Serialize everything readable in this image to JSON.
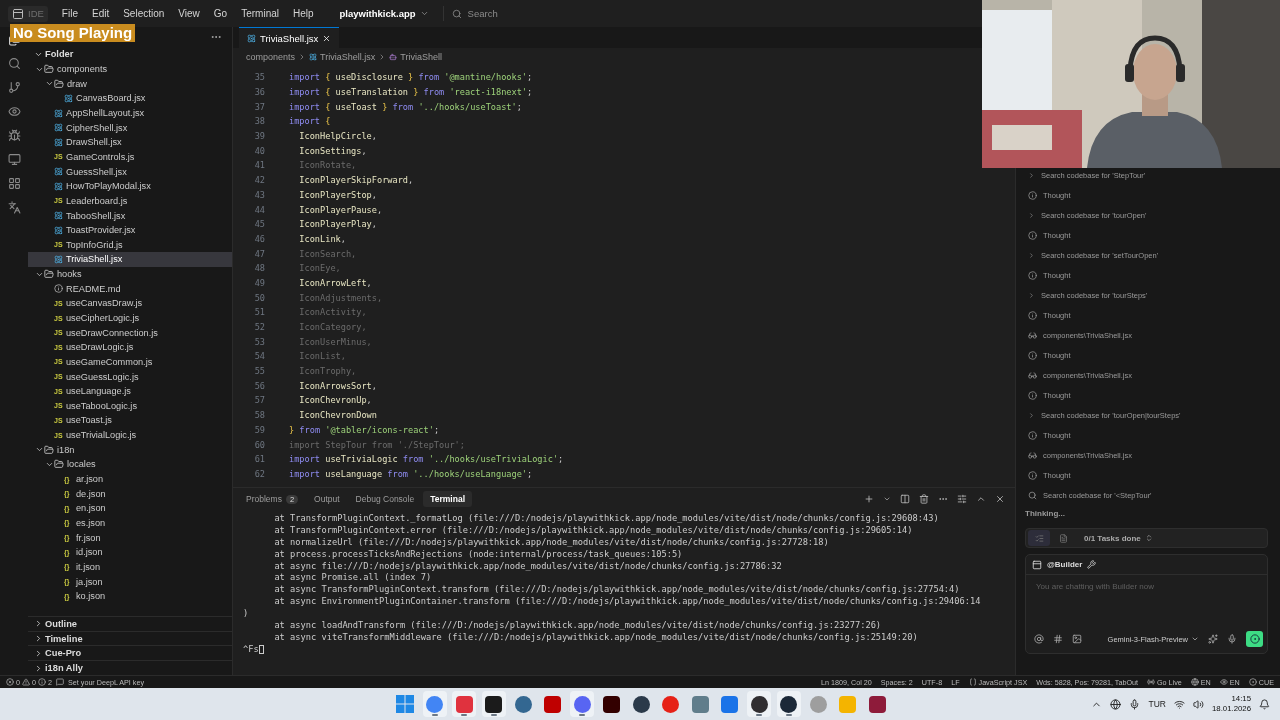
{
  "title_bar": {
    "app_label": "IDE",
    "menu": [
      "File",
      "Edit",
      "Selection",
      "View",
      "Go",
      "Terminal",
      "Help"
    ],
    "workspace": "playwithkick.app",
    "search": {
      "placeholder": "Search"
    }
  },
  "overlay": {
    "now_playing": "No Song Playing"
  },
  "sidebar": {
    "root": {
      "label": "Folder",
      "expanded": true
    },
    "tree": [
      {
        "label": "components",
        "kind": "folder",
        "expanded": true,
        "selected": false,
        "children": [
          {
            "label": "draw",
            "kind": "folder",
            "expanded": true,
            "selected": false,
            "children": [
              {
                "label": "CanvasBoard.jsx",
                "kind": "jsx",
                "selected": false
              }
            ]
          },
          {
            "label": "AppShellLayout.jsx",
            "kind": "jsx",
            "selected": false
          },
          {
            "label": "CipherShell.jsx",
            "kind": "jsx",
            "selected": false
          },
          {
            "label": "DrawShell.jsx",
            "kind": "jsx",
            "selected": false
          },
          {
            "label": "GameControls.js",
            "kind": "js",
            "badge": "JS",
            "selected": false
          },
          {
            "label": "GuessShell.jsx",
            "kind": "jsx",
            "selected": false
          },
          {
            "label": "HowToPlayModal.jsx",
            "kind": "jsx",
            "selected": false
          },
          {
            "label": "Leaderboard.js",
            "kind": "js",
            "badge": "JS",
            "selected": false
          },
          {
            "label": "TabooShell.jsx",
            "kind": "jsx",
            "selected": false
          },
          {
            "label": "ToastProvider.jsx",
            "kind": "jsx",
            "selected": false
          },
          {
            "label": "TopInfoGrid.js",
            "kind": "js",
            "badge": "JS",
            "selected": false
          },
          {
            "label": "TriviaShell.jsx",
            "kind": "jsx",
            "selected": true
          }
        ]
      },
      {
        "label": "hooks",
        "kind": "folder",
        "expanded": true,
        "selected": false,
        "children": [
          {
            "label": "README.md",
            "kind": "md",
            "selected": false
          },
          {
            "label": "useCanvasDraw.js",
            "kind": "js",
            "badge": "JS",
            "selected": false
          },
          {
            "label": "useCipherLogic.js",
            "kind": "js",
            "badge": "JS",
            "selected": false
          },
          {
            "label": "useDrawConnection.js",
            "kind": "js",
            "badge": "JS",
            "selected": false
          },
          {
            "label": "useDrawLogic.js",
            "kind": "js",
            "badge": "JS",
            "selected": false
          },
          {
            "label": "useGameCommon.js",
            "kind": "js",
            "badge": "JS",
            "selected": false
          },
          {
            "label": "useGuessLogic.js",
            "kind": "js",
            "badge": "JS",
            "selected": false
          },
          {
            "label": "useLanguage.js",
            "kind": "js",
            "badge": "JS",
            "selected": false
          },
          {
            "label": "useTabooLogic.js",
            "kind": "js",
            "badge": "JS",
            "selected": false
          },
          {
            "label": "useToast.js",
            "kind": "js",
            "badge": "JS",
            "selected": false
          },
          {
            "label": "useTrivialLogic.js",
            "kind": "js",
            "badge": "JS",
            "selected": false
          }
        ]
      },
      {
        "label": "i18n",
        "kind": "folder",
        "expanded": true,
        "selected": false,
        "children": [
          {
            "label": "locales",
            "kind": "folder",
            "expanded": true,
            "selected": false,
            "children": [
              {
                "label": "ar.json",
                "kind": "json",
                "badge": "{}",
                "selected": false
              },
              {
                "label": "de.json",
                "kind": "json",
                "badge": "{}",
                "selected": false
              },
              {
                "label": "en.json",
                "kind": "json",
                "badge": "{}",
                "selected": false
              },
              {
                "label": "es.json",
                "kind": "json",
                "badge": "{}",
                "selected": false
              },
              {
                "label": "fr.json",
                "kind": "json",
                "badge": "{}",
                "selected": false
              },
              {
                "label": "id.json",
                "kind": "json",
                "badge": "{}",
                "selected": false
              },
              {
                "label": "it.json",
                "kind": "json",
                "badge": "{}",
                "selected": false
              },
              {
                "label": "ja.json",
                "kind": "json",
                "badge": "{}",
                "selected": false
              },
              {
                "label": "ko.json",
                "kind": "json",
                "badge": "{}",
                "selected": false
              }
            ]
          }
        ]
      }
    ],
    "sections": [
      {
        "label": "Outline",
        "expanded": false
      },
      {
        "label": "Timeline",
        "expanded": false
      },
      {
        "label": "Cue-Pro",
        "expanded": false
      },
      {
        "label": "i18n Ally",
        "expanded": false
      }
    ]
  },
  "editor": {
    "tabs": [
      {
        "label": "TriviaShell.jsx",
        "selected": true
      }
    ],
    "breadcrumb": [
      "components",
      "TriviaShell.jsx",
      "TriviaShell"
    ],
    "lines": [
      {
        "number": "35",
        "tokens": [
          {
            "kind": "kw",
            "text": "import "
          },
          {
            "kind": "br",
            "text": "{ "
          },
          {
            "kind": "id",
            "text": "useDisclosure "
          },
          {
            "kind": "br",
            "text": "} "
          },
          {
            "kind": "kw",
            "text": "from "
          },
          {
            "kind": "str",
            "text": "'@mantine/hooks'"
          },
          {
            "kind": "p",
            "text": ";"
          }
        ]
      },
      {
        "number": "36",
        "tokens": [
          {
            "kind": "kw",
            "text": "import "
          },
          {
            "kind": "br",
            "text": "{ "
          },
          {
            "kind": "id",
            "text": "useTranslation "
          },
          {
            "kind": "br",
            "text": "} "
          },
          {
            "kind": "kw",
            "text": "from "
          },
          {
            "kind": "str",
            "text": "'react-i18next'"
          },
          {
            "kind": "p",
            "text": ";"
          }
        ]
      },
      {
        "number": "37",
        "tokens": [
          {
            "kind": "kw",
            "text": "import "
          },
          {
            "kind": "br",
            "text": "{ "
          },
          {
            "kind": "id",
            "text": "useToast "
          },
          {
            "kind": "br",
            "text": "} "
          },
          {
            "kind": "kw",
            "text": "from "
          },
          {
            "kind": "str",
            "text": "'../hooks/useToast'"
          },
          {
            "kind": "p",
            "text": ";"
          }
        ]
      },
      {
        "number": "38",
        "tokens": [
          {
            "kind": "kw",
            "text": "import "
          },
          {
            "kind": "br",
            "text": "{"
          }
        ]
      },
      {
        "number": "39",
        "tokens": [
          {
            "kind": "id",
            "text": "  IconHelpCircle"
          },
          {
            "kind": "p",
            "text": ","
          }
        ]
      },
      {
        "number": "40",
        "tokens": [
          {
            "kind": "id",
            "text": "  IconSettings"
          },
          {
            "kind": "p",
            "text": ","
          }
        ]
      },
      {
        "number": "41",
        "tokens": [
          {
            "kind": "dim",
            "text": "  IconRotate,"
          }
        ]
      },
      {
        "number": "42",
        "tokens": [
          {
            "kind": "id",
            "text": "  IconPlayerSkipForward"
          },
          {
            "kind": "p",
            "text": ","
          }
        ]
      },
      {
        "number": "43",
        "tokens": [
          {
            "kind": "id",
            "text": "  IconPlayerStop"
          },
          {
            "kind": "p",
            "text": ","
          }
        ]
      },
      {
        "number": "44",
        "tokens": [
          {
            "kind": "id",
            "text": "  IconPlayerPause"
          },
          {
            "kind": "p",
            "text": ","
          }
        ]
      },
      {
        "number": "45",
        "tokens": [
          {
            "kind": "id",
            "text": "  IconPlayerPlay"
          },
          {
            "kind": "p",
            "text": ","
          }
        ]
      },
      {
        "number": "46",
        "tokens": [
          {
            "kind": "id",
            "text": "  IconLink"
          },
          {
            "kind": "p",
            "text": ","
          }
        ]
      },
      {
        "number": "47",
        "tokens": [
          {
            "kind": "dim",
            "text": "  IconSearch,"
          }
        ]
      },
      {
        "number": "48",
        "tokens": [
          {
            "kind": "dim",
            "text": "  IconEye,"
          }
        ]
      },
      {
        "number": "49",
        "tokens": [
          {
            "kind": "id",
            "text": "  IconArrowLeft"
          },
          {
            "kind": "p",
            "text": ","
          }
        ]
      },
      {
        "number": "50",
        "tokens": [
          {
            "kind": "dim",
            "text": "  IconAdjustments,"
          }
        ]
      },
      {
        "number": "51",
        "tokens": [
          {
            "kind": "dim",
            "text": "  IconActivity,"
          }
        ]
      },
      {
        "number": "52",
        "tokens": [
          {
            "kind": "dim",
            "text": "  IconCategory,"
          }
        ]
      },
      {
        "number": "53",
        "tokens": [
          {
            "kind": "dim",
            "text": "  IconUserMinus,"
          }
        ]
      },
      {
        "number": "54",
        "tokens": [
          {
            "kind": "dim",
            "text": "  IconList,"
          }
        ]
      },
      {
        "number": "55",
        "tokens": [
          {
            "kind": "dim",
            "text": "  IconTrophy,"
          }
        ]
      },
      {
        "number": "56",
        "tokens": [
          {
            "kind": "id",
            "text": "  IconArrowsSort"
          },
          {
            "kind": "p",
            "text": ","
          }
        ]
      },
      {
        "number": "57",
        "tokens": [
          {
            "kind": "id",
            "text": "  IconChevronUp"
          },
          {
            "kind": "p",
            "text": ","
          }
        ]
      },
      {
        "number": "58",
        "tokens": [
          {
            "kind": "id",
            "text": "  IconChevronDown"
          }
        ]
      },
      {
        "number": "59",
        "tokens": [
          {
            "kind": "br",
            "text": "} "
          },
          {
            "kind": "kw",
            "text": "from "
          },
          {
            "kind": "str",
            "text": "'@tabler/icons-react'"
          },
          {
            "kind": "p",
            "text": ";"
          }
        ]
      },
      {
        "number": "60",
        "tokens": [
          {
            "kind": "dim",
            "text": "import StepTour from './StepTour';"
          }
        ]
      },
      {
        "number": "61",
        "tokens": [
          {
            "kind": "kw",
            "text": "import "
          },
          {
            "kind": "id",
            "text": "useTriviaLogic "
          },
          {
            "kind": "kw",
            "text": "from "
          },
          {
            "kind": "str",
            "text": "'../hooks/useTriviaLogic'"
          },
          {
            "kind": "p",
            "text": ";"
          }
        ]
      },
      {
        "number": "62",
        "tokens": [
          {
            "kind": "kw",
            "text": "import "
          },
          {
            "kind": "id",
            "text": "useLanguage "
          },
          {
            "kind": "kw",
            "text": "from "
          },
          {
            "kind": "str",
            "text": "'../hooks/useLanguage'"
          },
          {
            "kind": "p",
            "text": ";"
          }
        ]
      }
    ]
  },
  "panel": {
    "tabs": [
      {
        "label": "Problems",
        "count": "2",
        "selected": false
      },
      {
        "label": "Output",
        "selected": false
      },
      {
        "label": "Debug Console",
        "selected": false
      },
      {
        "label": "Terminal",
        "selected": true
      }
    ],
    "lines": [
      "      at TransformPluginContext._formatLog (file:///D:/nodejs/playwithkick.app/node_modules/vite/dist/node/chunks/config.js:29608:43)",
      "      at TransformPluginContext.error (file:///D:/nodejs/playwithkick.app/node_modules/vite/dist/node/chunks/config.js:29605:14)",
      "      at normalizeUrl (file:///D:/nodejs/playwithkick.app/node_modules/vite/dist/node/chunks/config.js:27728:18)",
      "      at process.processTicksAndRejections (node:internal/process/task_queues:105:5)",
      "      at async file:///D:/nodejs/playwithkick.app/node_modules/vite/dist/node/chunks/config.js:27786:32",
      "      at async Promise.all (index 7)",
      "      at async TransformPluginContext.transform (file:///D:/nodejs/playwithkick.app/node_modules/vite/dist/node/chunks/config.js:27754:4)",
      "      at async EnvironmentPluginContainer.transform (file:///D:/nodejs/playwithkick.app/node_modules/vite/dist/node/chunks/config.js:29406:14",
      ")",
      "      at async loadAndTransform (file:///D:/nodejs/playwithkick.app/node_modules/vite/dist/node/chunks/config.js:23277:26)",
      "      at async viteTransformMiddleware (file:///D:/nodejs/playwithkick.app/node_modules/vite/dist/node/chunks/config.js:25149:20)"
    ],
    "prompt": "^Fs"
  },
  "chat": {
    "steps": [
      {
        "kind": "search",
        "text": "Search codebase for 'StepTour'"
      },
      {
        "kind": "thought",
        "text": "Thought"
      },
      {
        "kind": "search",
        "text": "Search codebase for 'tourOpen'"
      },
      {
        "kind": "thought",
        "text": "Thought"
      },
      {
        "kind": "search",
        "text": "Search codebase for 'setTourOpen'"
      },
      {
        "kind": "thought",
        "text": "Thought"
      },
      {
        "kind": "search",
        "text": "Search codebase for 'tourSteps'"
      },
      {
        "kind": "thought",
        "text": "Thought"
      },
      {
        "kind": "read",
        "text": "components\\TriviaShell.jsx"
      },
      {
        "kind": "thought",
        "text": "Thought"
      },
      {
        "kind": "read",
        "text": "components\\TriviaShell.jsx"
      },
      {
        "kind": "thought",
        "text": "Thought"
      },
      {
        "kind": "search",
        "text": "Search codebase for 'tourOpen|tourSteps'"
      },
      {
        "kind": "thought",
        "text": "Thought"
      },
      {
        "kind": "read",
        "text": "components\\TriviaShell.jsx"
      },
      {
        "kind": "thought",
        "text": "Thought"
      },
      {
        "kind": "searching",
        "text": "Search codebase for '<StepTour'"
      }
    ],
    "status": "Thinking...",
    "tasks": "0/1 Tasks done",
    "agent": "@Builder",
    "placeholder": "You are chatting with Builder now",
    "model": "Gemini-3-Flash-Preview"
  },
  "status_bar": {
    "errors": "0",
    "warnings": "0",
    "infos": "2",
    "message": "Set your DeepL API key",
    "right": [
      {
        "kind": "plain",
        "text": "Ln 1809, Col 20"
      },
      {
        "kind": "plain",
        "text": "Spaces: 2"
      },
      {
        "kind": "plain",
        "text": "UTF-8"
      },
      {
        "kind": "plain",
        "text": "LF"
      },
      {
        "kind": "language",
        "text": "JavaScript JSX"
      },
      {
        "kind": "plain",
        "text": "Wds: 5828, Pos: 79281, TabOut"
      },
      {
        "kind": "live",
        "text": "Go Live"
      },
      {
        "kind": "globe",
        "text": "EN"
      },
      {
        "kind": "eye",
        "text": "EN"
      },
      {
        "kind": "cue",
        "text": "CUE"
      }
    ]
  },
  "taskbar": {
    "apps": [
      {
        "kind": "start",
        "open": false
      },
      {
        "kind": "round",
        "color": "#4285f4",
        "open": true
      },
      {
        "kind": "square",
        "color": "#e0323e",
        "open": true
      },
      {
        "kind": "square",
        "color": "#1b1b1b",
        "open": true
      },
      {
        "kind": "round",
        "color": "#336791",
        "open": false
      },
      {
        "kind": "square",
        "color": "#bf0000",
        "open": false
      },
      {
        "kind": "round",
        "color": "#5865f2",
        "open": true
      },
      {
        "kind": "square",
        "color": "#330000",
        "open": false
      },
      {
        "kind": "round",
        "color": "#2b3a4a",
        "open": false
      },
      {
        "kind": "round",
        "color": "#e62117",
        "open": false
      },
      {
        "kind": "square",
        "color": "#607d8b",
        "open": false
      },
      {
        "kind": "square",
        "color": "#1a73e8",
        "open": false
      },
      {
        "kind": "round",
        "color": "#302e31",
        "open": true
      },
      {
        "kind": "round",
        "color": "#1b2838",
        "open": true
      },
      {
        "kind": "round",
        "color": "#9e9e9e",
        "open": false
      },
      {
        "kind": "square",
        "color": "#f4b400",
        "open": false
      },
      {
        "kind": "square",
        "color": "#8e1b3a",
        "open": false
      }
    ],
    "language": "TUR",
    "time": "14:15",
    "date": "18.01.2026"
  }
}
